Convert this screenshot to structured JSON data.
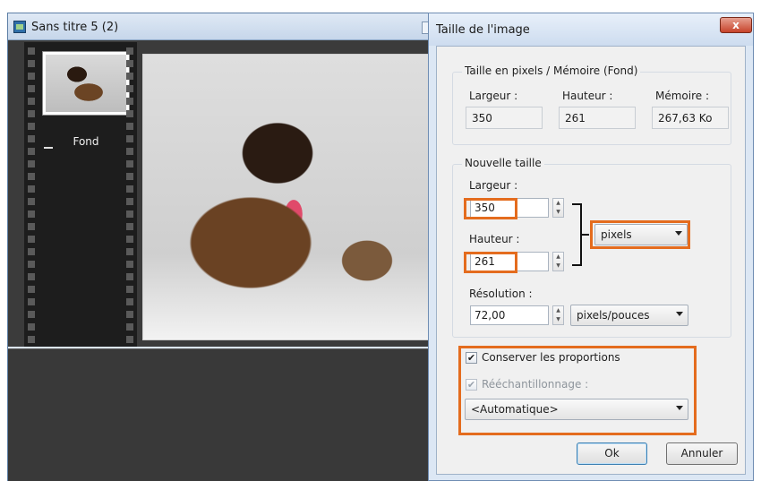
{
  "doc_window": {
    "title": "Sans titre 5 (2)",
    "layer_name": "Fond"
  },
  "dialog": {
    "title": "Taille de l'image",
    "close_label": "x",
    "pixels_group": {
      "title": "Taille en pixels / Mémoire (Fond)",
      "width_label": "Largeur :",
      "height_label": "Hauteur :",
      "memory_label": "Mémoire :",
      "width_value": "350",
      "height_value": "261",
      "memory_value": "267,63 Ko"
    },
    "new_size_group": {
      "title": "Nouvelle taille",
      "width_label": "Largeur :",
      "width_value": "350",
      "height_label": "Hauteur :",
      "height_value": "261",
      "unit_value": "pixels",
      "resolution_label": "Résolution :",
      "resolution_value": "72,00",
      "resolution_unit": "pixels/pouces"
    },
    "options": {
      "keep_proportions_label": "Conserver les proportions",
      "keep_proportions_checked": true,
      "resample_label": "Rééchantillonnage :",
      "resample_checked": true,
      "resample_method": "<Automatique>"
    },
    "ok_label": "Ok",
    "cancel_label": "Annuler"
  },
  "colors": {
    "highlight": "#e46c1e",
    "titlebar": "#cddcef",
    "dark_background": "#393939"
  },
  "icons": {
    "document": "document-icon",
    "close": "close-icon",
    "dropdown": "chevron-down-icon",
    "spinner": "spinner-arrows-icon",
    "check": "checkmark-icon"
  }
}
